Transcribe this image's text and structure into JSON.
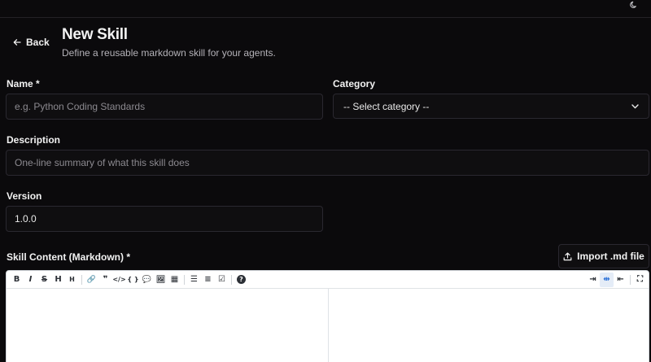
{
  "header": {
    "back_label": "Back",
    "title": "New Skill",
    "subtitle": "Define a reusable markdown skill for your agents."
  },
  "form": {
    "name": {
      "label": "Name *",
      "placeholder": "e.g. Python Coding Standards",
      "value": ""
    },
    "category": {
      "label": "Category",
      "selected": "-- Select category --"
    },
    "description": {
      "label": "Description",
      "placeholder": "One-line summary of what this skill does",
      "value": ""
    },
    "version": {
      "label": "Version",
      "value": "1.0.0"
    },
    "content": {
      "label": "Skill Content (Markdown) *",
      "import_label": "Import .md file"
    }
  },
  "toolbar": {
    "left": [
      {
        "name": "bold",
        "glyph": "B"
      },
      {
        "name": "italic",
        "glyph": "I"
      },
      {
        "name": "strikethrough",
        "glyph": "S"
      },
      {
        "name": "heading",
        "glyph": "H"
      },
      {
        "name": "heading-smaller",
        "glyph": "H"
      },
      {
        "name": "link",
        "glyph": "🔗"
      },
      {
        "name": "quote",
        "glyph": "❞"
      },
      {
        "name": "code",
        "glyph": "</>"
      },
      {
        "name": "code-block",
        "glyph": "{ }"
      },
      {
        "name": "comment",
        "glyph": "💬"
      },
      {
        "name": "image",
        "glyph": "🖼"
      },
      {
        "name": "table",
        "glyph": "▦"
      },
      {
        "name": "unordered-list",
        "glyph": "☰"
      },
      {
        "name": "ordered-list",
        "glyph": "≡"
      },
      {
        "name": "task-list",
        "glyph": "☑"
      },
      {
        "name": "help",
        "glyph": "?"
      }
    ],
    "right": [
      {
        "name": "edit-only",
        "glyph": "⇥"
      },
      {
        "name": "split-view",
        "glyph": "⇹"
      },
      {
        "name": "preview-only",
        "glyph": "⇤"
      },
      {
        "name": "fullscreen",
        "glyph": "⛶"
      }
    ],
    "active_color": "#2f73d8"
  },
  "colors": {
    "background": "#0b0a0c",
    "field_border": "#2a2830",
    "text": "#f2f2f2",
    "muted": "#b4b2b8"
  }
}
